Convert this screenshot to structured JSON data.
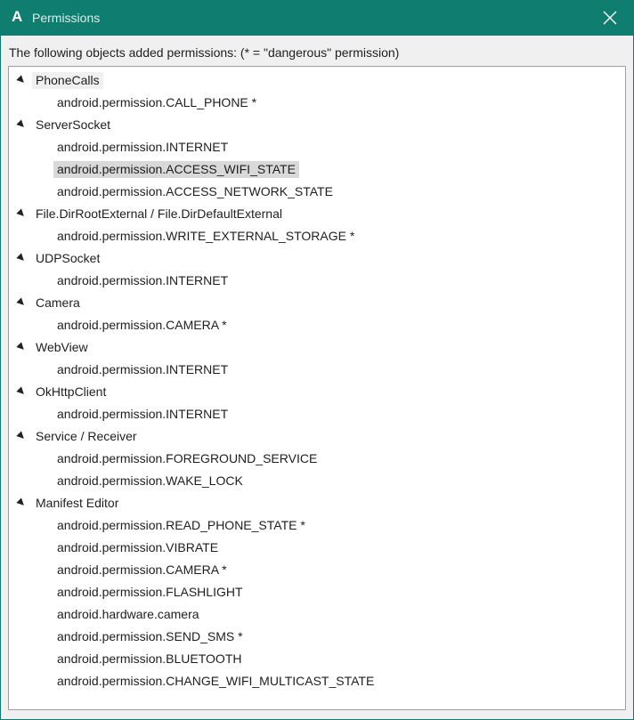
{
  "window": {
    "app_logo": "A",
    "title": "Permissions",
    "close_glyph": "close-icon"
  },
  "caption": "The following objects added permissions: (* = \"dangerous\" permission)",
  "tree": {
    "groups": [
      {
        "label": "PhoneCalls",
        "permissions": [
          "android.permission.CALL_PHONE *"
        ]
      },
      {
        "label": "ServerSocket",
        "permissions": [
          "android.permission.INTERNET",
          "android.permission.ACCESS_WIFI_STATE",
          "android.permission.ACCESS_NETWORK_STATE"
        ]
      },
      {
        "label": "File.DirRootExternal / File.DirDefaultExternal",
        "permissions": [
          "android.permission.WRITE_EXTERNAL_STORAGE *"
        ]
      },
      {
        "label": "UDPSocket",
        "permissions": [
          "android.permission.INTERNET"
        ]
      },
      {
        "label": "Camera",
        "permissions": [
          "android.permission.CAMERA *"
        ]
      },
      {
        "label": "WebView",
        "permissions": [
          "android.permission.INTERNET"
        ]
      },
      {
        "label": "OkHttpClient",
        "permissions": [
          "android.permission.INTERNET"
        ]
      },
      {
        "label": "Service / Receiver",
        "permissions": [
          "android.permission.FOREGROUND_SERVICE",
          "android.permission.WAKE_LOCK"
        ]
      },
      {
        "label": "Manifest Editor",
        "permissions": [
          "android.permission.READ_PHONE_STATE *",
          "android.permission.VIBRATE",
          "android.permission.CAMERA *",
          "android.permission.FLASHLIGHT",
          "android.hardware.camera",
          "android.permission.SEND_SMS *",
          "android.permission.BLUETOOTH",
          "android.permission.CHANGE_WIFI_MULTICAST_STATE"
        ]
      }
    ],
    "selected": "android.permission.ACCESS_WIFI_STATE"
  },
  "colors": {
    "titlebar": "#0f7d6f",
    "selection": "#d9d9d9"
  }
}
